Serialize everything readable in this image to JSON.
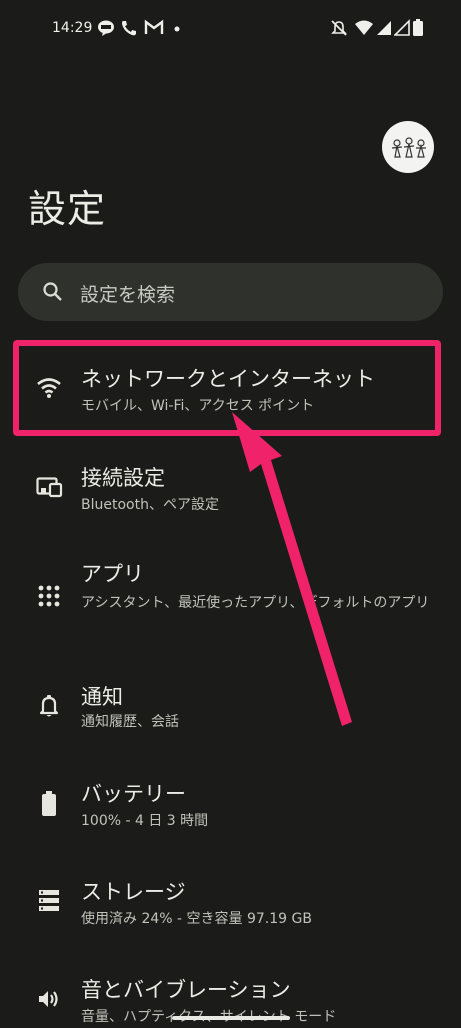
{
  "status_bar": {
    "time": "14:29",
    "left_icons": [
      "line-icon",
      "phone-icon",
      "gmail-icon",
      "dot-icon"
    ],
    "right_icons": [
      "mute-icon",
      "wifi-icon",
      "signal-icon",
      "signal-icon",
      "battery-icon"
    ]
  },
  "page": {
    "title": "設定"
  },
  "search": {
    "placeholder": "設定を検索"
  },
  "items": [
    {
      "title": "ネットワークとインターネット",
      "subtitle": "モバイル、Wi-Fi、アクセス ポイント",
      "icon": "wifi-icon"
    },
    {
      "title": "接続設定",
      "subtitle": "Bluetooth、ペア設定",
      "icon": "devices-icon"
    },
    {
      "title": "アプリ",
      "subtitle": "アシスタント、最近使ったアプリ、デフォルトのアプリ",
      "icon": "apps-grid-icon"
    },
    {
      "title": "通知",
      "subtitle": "通知履歴、会話",
      "icon": "bell-icon"
    },
    {
      "title": "バッテリー",
      "subtitle": "100% - 4 日 3 時間",
      "icon": "battery-icon"
    },
    {
      "title": "ストレージ",
      "subtitle": "使用済み 24% - 空き容量 97.19 GB",
      "icon": "storage-icon"
    },
    {
      "title": "音とバイブレーション",
      "subtitle": "音量、ハプティクス、サイレント モード",
      "icon": "volume-icon"
    }
  ],
  "colors": {
    "background": "#1b1c19",
    "highlight": "#f0226a",
    "search_bg": "#2e312c"
  }
}
